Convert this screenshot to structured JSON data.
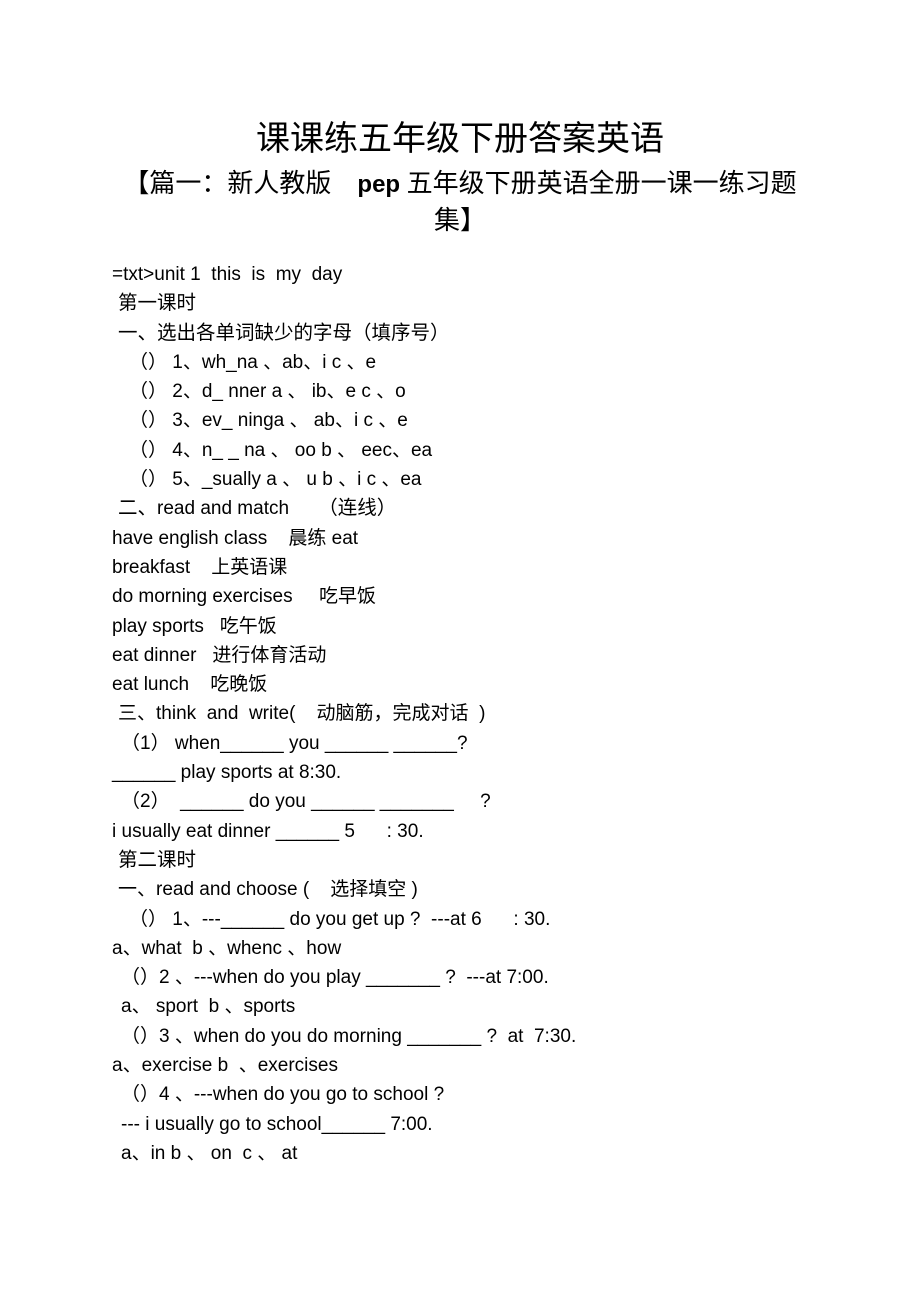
{
  "document": {
    "title": "课课练五年级下册答案英语",
    "subtitle_parts": {
      "before": "【篇一：新人教版",
      "latin": "pep",
      "after": "五年级下册英语全册一课一练习题集】"
    },
    "subtitle_full": "【篇一：新人教版　pep 五年级下册英语全册一课一练习题集】"
  },
  "content": {
    "unit_header": "=txt>unit 1  this  is  my  day",
    "lesson1": {
      "label": "第一课时",
      "section1": {
        "heading": "一、选出各单词缺少的字母（填序号）",
        "items": [
          "（） 1、wh_na 、ab、i c 、e",
          "（） 2、d_ nner a 、 ib、e c 、o",
          "（） 3、ev_ ninga 、 ab、i c 、e",
          "（） 4、n_ _ na 、 oo b 、 eec、ea",
          "（） 5、_sually a 、 u b 、i c 、ea"
        ]
      },
      "section2": {
        "heading_latin": "二、read and match",
        "heading_cn": "（连线）",
        "pairs": [
          "have english class    晨练 eat",
          "breakfast    上英语课",
          "do morning exercises     吃早饭",
          "play sports   吃午饭",
          "eat dinner   进行体育活动",
          "eat lunch    吃晚饭"
        ]
      },
      "section3": {
        "heading": "三、think  and  write(    动脑筋，完成对话  )",
        "lines": [
          "（1） when______ you ______ ______?",
          "______ play sports at 8:30.",
          "（2）  ______ do you ______ _______     ?",
          "i usually eat dinner ______ 5      : 30."
        ]
      }
    },
    "lesson2": {
      "label": "第二课时",
      "section1": {
        "heading": "一、read and choose (    选择填空 )",
        "questions": [
          {
            "prompt": "（） 1、---______ do you get up ?  ---at 6      : 30.",
            "options": "a、what  b 、whenc 、how"
          },
          {
            "prompt": "（）2 、---when do you play _______ ?  ---at 7:00.",
            "options": "a、 sport  b 、sports"
          },
          {
            "prompt": "（）3 、when do you do morning _______ ?  at  7:30.",
            "options": "a、exercise b  、exercises"
          },
          {
            "prompt": "（）4 、---when do you go to school ?",
            "answer_line": "--- i usually go to school______ 7:00.",
            "options": "a、in b 、 on  c 、 at"
          }
        ]
      }
    }
  }
}
